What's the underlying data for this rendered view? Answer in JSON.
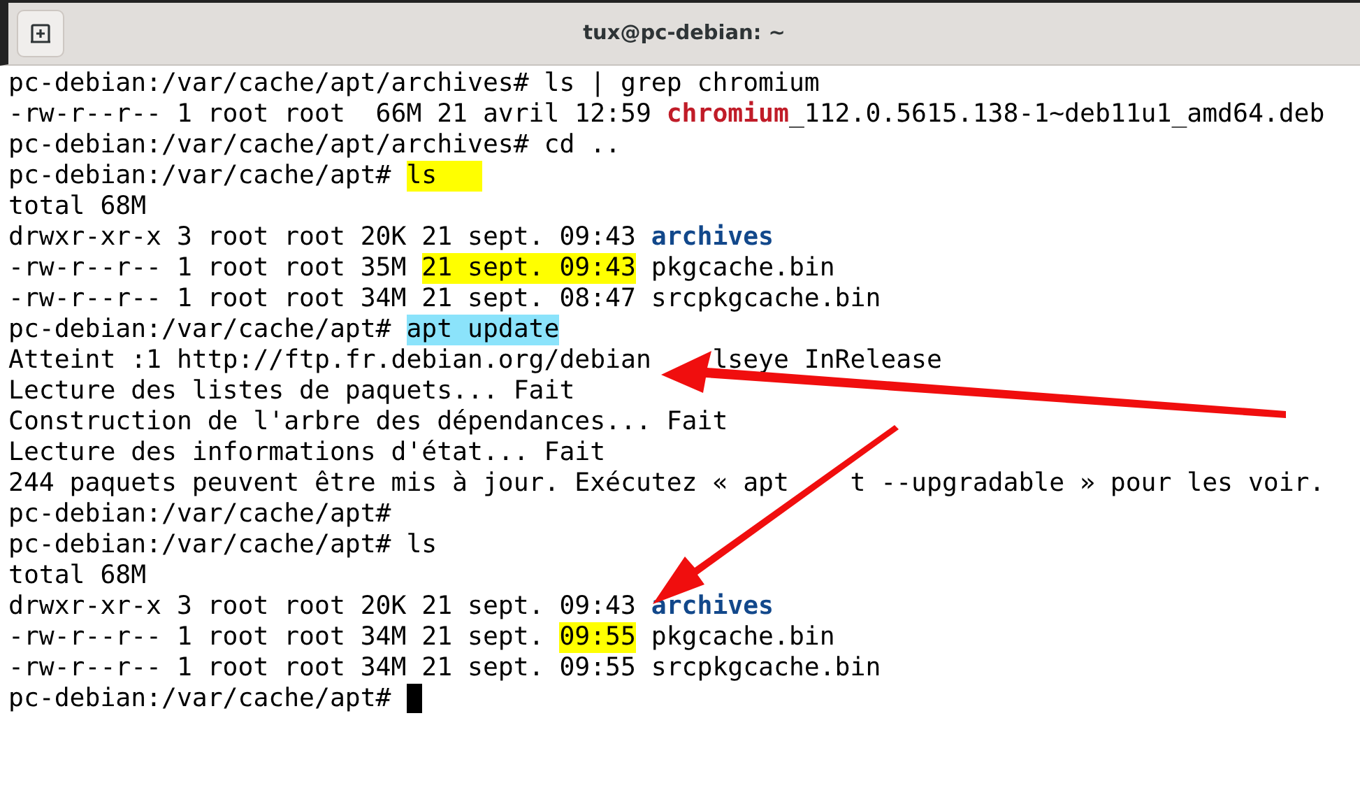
{
  "window": {
    "title": "tux@pc-debian: ~"
  },
  "terminal": {
    "lines": [
      {
        "segments": [
          {
            "kind": "plain",
            "text": "pc-debian:/var/cache/apt/archives# ls | grep chromium"
          }
        ]
      },
      {
        "segments": [
          {
            "kind": "plain",
            "text": "-rw-r--r-- 1 root root  66M 21 avril 12:59 "
          },
          {
            "kind": "match",
            "text": "chromium"
          },
          {
            "kind": "plain",
            "text": "_112.0.5615.138-1~deb11u1_amd64.deb"
          }
        ]
      },
      {
        "segments": [
          {
            "kind": "plain",
            "text": "pc-debian:/var/cache/apt/archives# cd .."
          }
        ]
      },
      {
        "segments": [
          {
            "kind": "plain",
            "text": "pc-debian:/var/cache/apt# "
          },
          {
            "kind": "mark-yellow",
            "text": "ls   "
          }
        ]
      },
      {
        "segments": [
          {
            "kind": "plain",
            "text": "total 68M"
          }
        ]
      },
      {
        "segments": [
          {
            "kind": "plain",
            "text": "drwxr-xr-x 3 root root 20K 21 sept. 09:43 "
          },
          {
            "kind": "directory",
            "text": "archives"
          }
        ]
      },
      {
        "segments": [
          {
            "kind": "plain",
            "text": "-rw-r--r-- 1 root root 35M "
          },
          {
            "kind": "mark-yellow",
            "text": "21 sept. 09:43"
          },
          {
            "kind": "plain",
            "text": " pkgcache.bin"
          }
        ]
      },
      {
        "segments": [
          {
            "kind": "plain",
            "text": "-rw-r--r-- 1 root root 34M 21 sept. 08:47 srcpkgcache.bin"
          }
        ]
      },
      {
        "segments": [
          {
            "kind": "plain",
            "text": "pc-debian:/var/cache/apt# "
          },
          {
            "kind": "mark-cyan",
            "text": "apt update"
          }
        ]
      },
      {
        "segments": [
          {
            "kind": "plain",
            "text": "Atteint :1 http://ftp.fr.debian.org/debian"
          },
          {
            "kind": "plain",
            "text": "    lseye InRelease"
          }
        ]
      },
      {
        "segments": [
          {
            "kind": "plain",
            "text": "Lecture des listes de paquets... Fait"
          }
        ]
      },
      {
        "segments": [
          {
            "kind": "plain",
            "text": "Construction de l'arbre des dépendances... Fait"
          }
        ]
      },
      {
        "segments": [
          {
            "kind": "plain",
            "text": "Lecture des informations d'état... Fait"
          }
        ]
      },
      {
        "segments": [
          {
            "kind": "plain",
            "text": "244 paquets peuvent être mis à jour. Exécutez « apt"
          },
          {
            "kind": "plain",
            "text": "    t --upgradable » pour les voir."
          }
        ]
      },
      {
        "segments": [
          {
            "kind": "plain",
            "text": "pc-debian:/var/cache/apt#"
          }
        ]
      },
      {
        "segments": [
          {
            "kind": "plain",
            "text": "pc-debian:/var/cache/apt# ls"
          }
        ]
      },
      {
        "segments": [
          {
            "kind": "plain",
            "text": "total 68M"
          }
        ]
      },
      {
        "segments": [
          {
            "kind": "plain",
            "text": "drwxr-xr-x 3 root root 20K 21 sept. 09:43 "
          },
          {
            "kind": "directory",
            "text": "archives"
          }
        ]
      },
      {
        "segments": [
          {
            "kind": "plain",
            "text": "-rw-r--r-- 1 root root 34M 21 sept. "
          },
          {
            "kind": "mark-yellow",
            "text": "09:55"
          },
          {
            "kind": "plain",
            "text": " pkgcache.bin"
          }
        ]
      },
      {
        "segments": [
          {
            "kind": "plain",
            "text": "-rw-r--r-- 1 root root 34M 21 sept. 09:55 srcpkgcache.bin"
          }
        ]
      },
      {
        "segments": [
          {
            "kind": "plain",
            "text": "pc-debian:/var/cache/apt# "
          }
        ],
        "cursor": true
      }
    ]
  }
}
